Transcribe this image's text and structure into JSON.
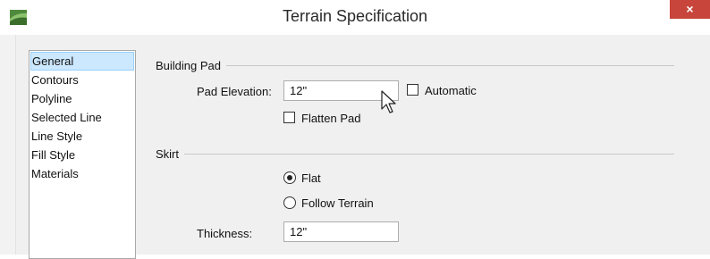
{
  "window": {
    "title": "Terrain Specification",
    "close_glyph": "×",
    "app_icon": "terrain-app-icon",
    "accent_close": "#c7453a"
  },
  "nav": {
    "items": [
      {
        "label": "General",
        "selected": true
      },
      {
        "label": "Contours"
      },
      {
        "label": "Polyline"
      },
      {
        "label": "Selected Line"
      },
      {
        "label": "Line Style"
      },
      {
        "label": "Fill Style"
      },
      {
        "label": "Materials"
      }
    ]
  },
  "building_pad": {
    "group_label": "Building Pad",
    "pad_elevation_label": "Pad Elevation:",
    "pad_elevation_value": "12\"",
    "automatic_label": "Automatic",
    "automatic_checked": false,
    "flatten_pad_label": "Flatten Pad",
    "flatten_pad_checked": false
  },
  "skirt": {
    "group_label": "Skirt",
    "flat_label": "Flat",
    "flat_selected": true,
    "follow_terrain_label": "Follow Terrain",
    "follow_terrain_selected": false,
    "thickness_label": "Thickness:",
    "thickness_value": "12\""
  }
}
